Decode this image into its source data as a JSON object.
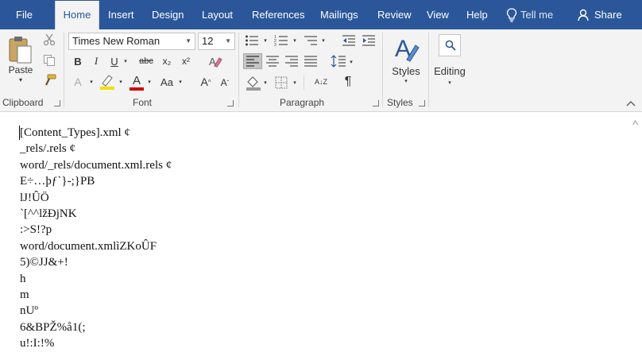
{
  "tabs": {
    "file": "File",
    "home": "Home",
    "insert": "Insert",
    "design": "Design",
    "layout": "Layout",
    "references": "References",
    "mailings": "Mailings",
    "review": "Review",
    "view": "View",
    "help": "Help",
    "tell_me": "Tell me",
    "share": "Share"
  },
  "ribbon": {
    "clipboard": {
      "paste": "Paste",
      "label": "Clipboard"
    },
    "font": {
      "name": "Times New Roman",
      "size": "12",
      "bold": "B",
      "italic": "I",
      "underline": "U",
      "strikethrough": "abc",
      "subscript": "x₂",
      "superscript": "x²",
      "text_effects": "A",
      "font_color": "A",
      "change_case": "Aa",
      "grow": "A",
      "shrink": "A",
      "label": "Font"
    },
    "paragraph": {
      "sort": "A↓Z",
      "show_marks": "¶",
      "label": "Paragraph"
    },
    "styles": {
      "styles": "Styles",
      "label": "Styles"
    },
    "editing": {
      "editing": "Editing"
    }
  },
  "colors": {
    "accent": "#2b579a",
    "highlight": "#f0e000",
    "font_color": "#d00000"
  },
  "document": {
    "lines": [
      "[Content_Types].xml ¢",
      "_rels/.rels ¢",
      "word/_rels/document.xml.rels ¢",
      "E÷…þƒ`}-;}PB",
      "lJ!ÛÖ",
      "`[^^lžÐjNK",
      ":>S!?p",
      "word/document.xmlìZKoÛF",
      "5)©JJ&+!",
      "h",
      "m",
      "nUº",
      "6&BPŽ%å1(;",
      "u!:I:!%"
    ]
  }
}
